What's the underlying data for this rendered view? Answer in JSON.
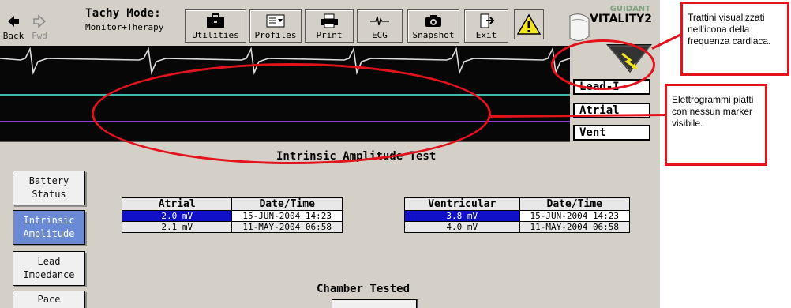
{
  "toolbar": {
    "back_label": "Back",
    "fwd_label": "Fwd",
    "mode_title": "Tachy Mode:",
    "mode_value": "Monitor+Therapy",
    "utilities_label": "Utilities",
    "profiles_label": "Profiles",
    "print_label": "Print",
    "ecg_label": "ECG",
    "snapshot_label": "Snapshot",
    "exit_label": "Exit"
  },
  "brand": {
    "maker": "GUIDANT",
    "model": "VITALITY2"
  },
  "leads": [
    "Lead-I",
    "Atrial",
    "Vent"
  ],
  "test_title": "Intrinsic Amplitude Test",
  "side_buttons": [
    {
      "line1": "Battery",
      "line2": "Status",
      "active": false
    },
    {
      "line1": "Intrinsic",
      "line2": "Amplitude",
      "active": true
    },
    {
      "line1": "Lead",
      "line2": "Impedance",
      "active": false
    },
    {
      "line1": "Pace",
      "line2": "",
      "active": false
    }
  ],
  "atrial_table": {
    "headers": [
      "Atrial",
      "Date/Time"
    ],
    "rows": [
      [
        "2.0 mV",
        "15-JUN-2004 14:23"
      ],
      [
        "2.1 mV",
        "11-MAY-2004 06:58"
      ]
    ]
  },
  "ventricular_table": {
    "headers": [
      "Ventricular",
      "Date/Time"
    ],
    "rows": [
      [
        "3.8 mV",
        "15-JUN-2004 14:23"
      ],
      [
        "4.0 mV",
        "11-MAY-2004 06:58"
      ]
    ]
  },
  "chamber_title": "Chamber Tested",
  "annotations": {
    "heart_note": "Trattini visualizzati nell'icona della frequenza cardiaca.",
    "egm_note": "Elettrogrammi piatti con nessun marker visibile."
  },
  "colors": {
    "annotation_red": "#e4121b",
    "selected_blue": "#1010c8",
    "active_button": "#6a8ad6",
    "atrial_trace": "#3fb8b0",
    "vent_trace": "#8a3fd0"
  }
}
